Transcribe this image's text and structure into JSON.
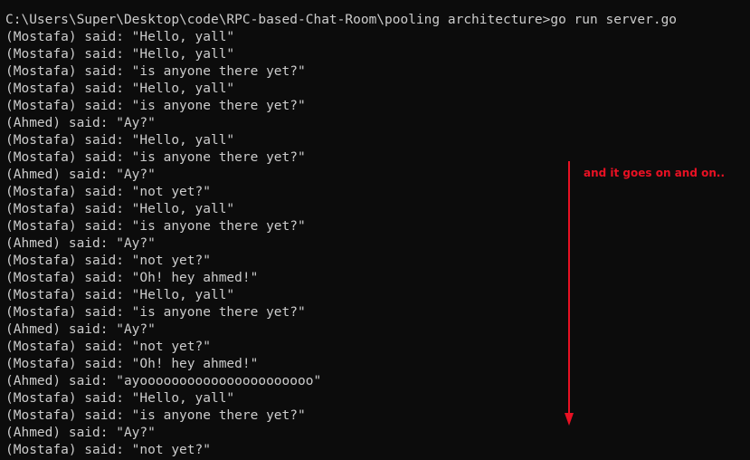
{
  "terminal": {
    "prompt": "C:\\Users\\Super\\Desktop\\code\\RPC-based-Chat-Room\\pooling architecture>go run server.go",
    "lines": [
      "(Mostafa) said: \"Hello, yall\"",
      "(Mostafa) said: \"Hello, yall\"",
      "(Mostafa) said: \"is anyone there yet?\"",
      "(Mostafa) said: \"Hello, yall\"",
      "(Mostafa) said: \"is anyone there yet?\"",
      "(Ahmed) said: \"Ay?\"",
      "(Mostafa) said: \"Hello, yall\"",
      "(Mostafa) said: \"is anyone there yet?\"",
      "(Ahmed) said: \"Ay?\"",
      "(Mostafa) said: \"not yet?\"",
      "(Mostafa) said: \"Hello, yall\"",
      "(Mostafa) said: \"is anyone there yet?\"",
      "(Ahmed) said: \"Ay?\"",
      "(Mostafa) said: \"not yet?\"",
      "(Mostafa) said: \"Oh! hey ahmed!\"",
      "(Mostafa) said: \"Hello, yall\"",
      "(Mostafa) said: \"is anyone there yet?\"",
      "(Ahmed) said: \"Ay?\"",
      "(Mostafa) said: \"not yet?\"",
      "(Mostafa) said: \"Oh! hey ahmed!\"",
      "(Ahmed) said: \"ayoooooooooooooooooooooo\"",
      "(Mostafa) said: \"Hello, yall\"",
      "(Mostafa) said: \"is anyone there yet?\"",
      "(Ahmed) said: \"Ay?\"",
      "(Mostafa) said: \"not yet?\""
    ]
  },
  "annotation": {
    "text": "and it goes on and on..",
    "arrow_icon": "arrow-down-icon"
  },
  "colors": {
    "background": "#0c0c0c",
    "text": "#cccccc",
    "annotation": "#e81123"
  }
}
